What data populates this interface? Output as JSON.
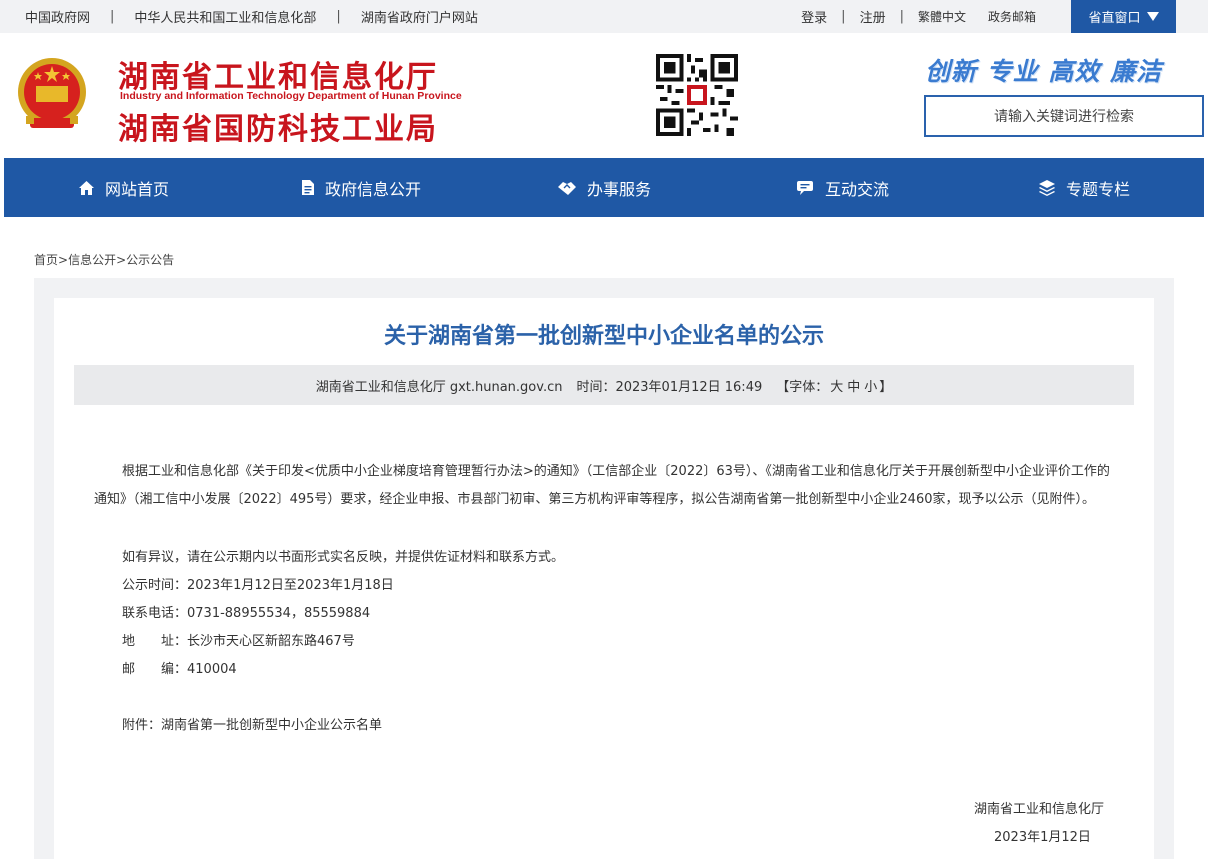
{
  "topbar": {
    "links": [
      "中国政府网",
      "中华人民共和国工业和信息化部",
      "湖南省政府门户网站"
    ],
    "separator": "|",
    "login": "登录",
    "register": "注册",
    "traditional": "繁體中文",
    "gov_mail": "政务邮箱",
    "window_btn": "省直窗口"
  },
  "header": {
    "title_cn_1": "湖南省工业和信息化厅",
    "title_en": "Industry and Information Technology Department of Hunan Province",
    "title_cn_2": "湖南省国防科技工业局",
    "slogan": "创新 专业 高效 廉洁",
    "search_placeholder": "请输入关键词进行检索"
  },
  "nav": {
    "items": [
      {
        "label": "网站首页",
        "icon": "home-icon"
      },
      {
        "label": "政府信息公开",
        "icon": "document-icon"
      },
      {
        "label": "办事服务",
        "icon": "handshake-icon"
      },
      {
        "label": "互动交流",
        "icon": "chat-icon"
      },
      {
        "label": "专题专栏",
        "icon": "layers-icon"
      }
    ]
  },
  "breadcrumb": {
    "items": [
      "首页",
      "信息公开",
      "公示公告"
    ],
    "sep": ">"
  },
  "article": {
    "title": "关于湖南省第一批创新型中小企业名单的公示",
    "source": "湖南省工业和信息化厅 gxt.hunan.gov.cn",
    "time": "时间：2023年01月12日 16:49",
    "font_label": "【字体：",
    "font_large": "大",
    "font_medium": "中",
    "font_small": "小",
    "font_close": "】",
    "paragraph_1": "根据工业和信息化部《关于印发<优质中小企业梯度培育管理暂行办法>的通知》（工信部企业〔2022〕63号）、《湖南省工业和信息化厅关于开展创新型中小企业评价工作的通知》（湘工信中小发展〔2022〕495号）要求，经企业申报、市县部门初审、第三方机构评审等程序，拟公告湖南省第一批创新型中小企业2460家，现予以公示（见附件）。",
    "paragraph_2": "如有异议，请在公示期内以书面形式实名反映，并提供佐证材料和联系方式。",
    "period": "公示时间：2023年1月12日至2023年1月18日",
    "phone": "联系电话：0731-88955534，85559884",
    "address_label": "地　　址：",
    "address": "长沙市天心区新韶东路467号",
    "postcode_label": "邮　　编：",
    "postcode": "410004",
    "attachment_label": "附件：",
    "attachment": "湖南省第一批创新型中小企业公示名单",
    "signature": "湖南省工业和信息化厅",
    "date": "2023年1月12日"
  },
  "colors": {
    "brand_blue": "#1f58a5",
    "brand_red": "#c8151d",
    "title_blue": "#2b62a9"
  }
}
